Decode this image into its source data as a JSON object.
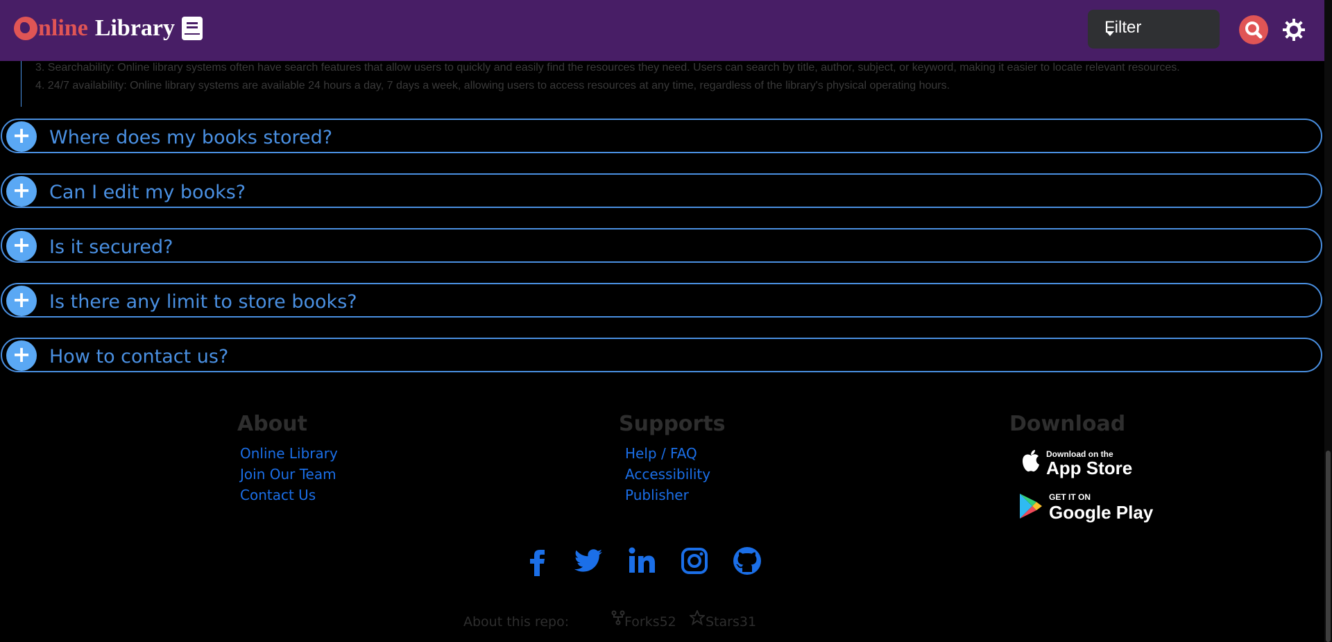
{
  "header": {
    "logo_o": "O",
    "logo_nline": "nline",
    "logo_library": "Library",
    "filter_label": "Filter"
  },
  "answer_lines": [
    "3. Searchability: Online library systems often have search features that allow users to quickly and easily find the resources they need. Users can search by title, author, subject, or keyword, making it easier to locate relevant resources.",
    "4. 24/7 availability: Online library systems are available 24 hours a day, 7 days a week, allowing users to access resources at any time, regardless of the library's physical operating hours."
  ],
  "faq": [
    {
      "question": "Where does my books stored?"
    },
    {
      "question": "Can I edit my books?"
    },
    {
      "question": "Is it secured?"
    },
    {
      "question": "Is there any limit to store books?"
    },
    {
      "question": "How to contact us?"
    }
  ],
  "footer": {
    "about": {
      "title": "About",
      "links": [
        "Online Library",
        "Join Our Team",
        "Contact Us"
      ]
    },
    "supports": {
      "title": "Supports",
      "links": [
        "Help / FAQ",
        "Accessibility",
        "Publisher"
      ]
    },
    "download": {
      "title": "Download",
      "appstore_small": "Download on the",
      "appstore_big": "App Store",
      "googleplay_small": "GET IT ON",
      "googleplay_big": "Google Play"
    },
    "social": [
      "facebook-icon",
      "twitter-icon",
      "linkedin-icon",
      "instagram-icon",
      "github-icon"
    ],
    "repo": {
      "label": "About this repo:",
      "forks": "Forks52",
      "stars": "Stars31"
    }
  },
  "colors": {
    "header_bg": "#481e66",
    "accent": "#4a90e2",
    "link": "#1b6fe8",
    "brand_red": "#e05555"
  }
}
